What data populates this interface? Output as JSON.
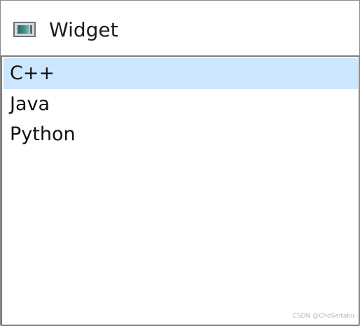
{
  "window": {
    "title": "Widget",
    "icon": "window-icon"
  },
  "list": {
    "selected_index": 0,
    "items": [
      {
        "label": "C++"
      },
      {
        "label": "Java"
      },
      {
        "label": "Python"
      }
    ]
  },
  "watermark": "CSDN @ChoSeitaku",
  "colors": {
    "selection": "#cce6ff",
    "border": "#7e7e7e",
    "text": "#111111"
  }
}
